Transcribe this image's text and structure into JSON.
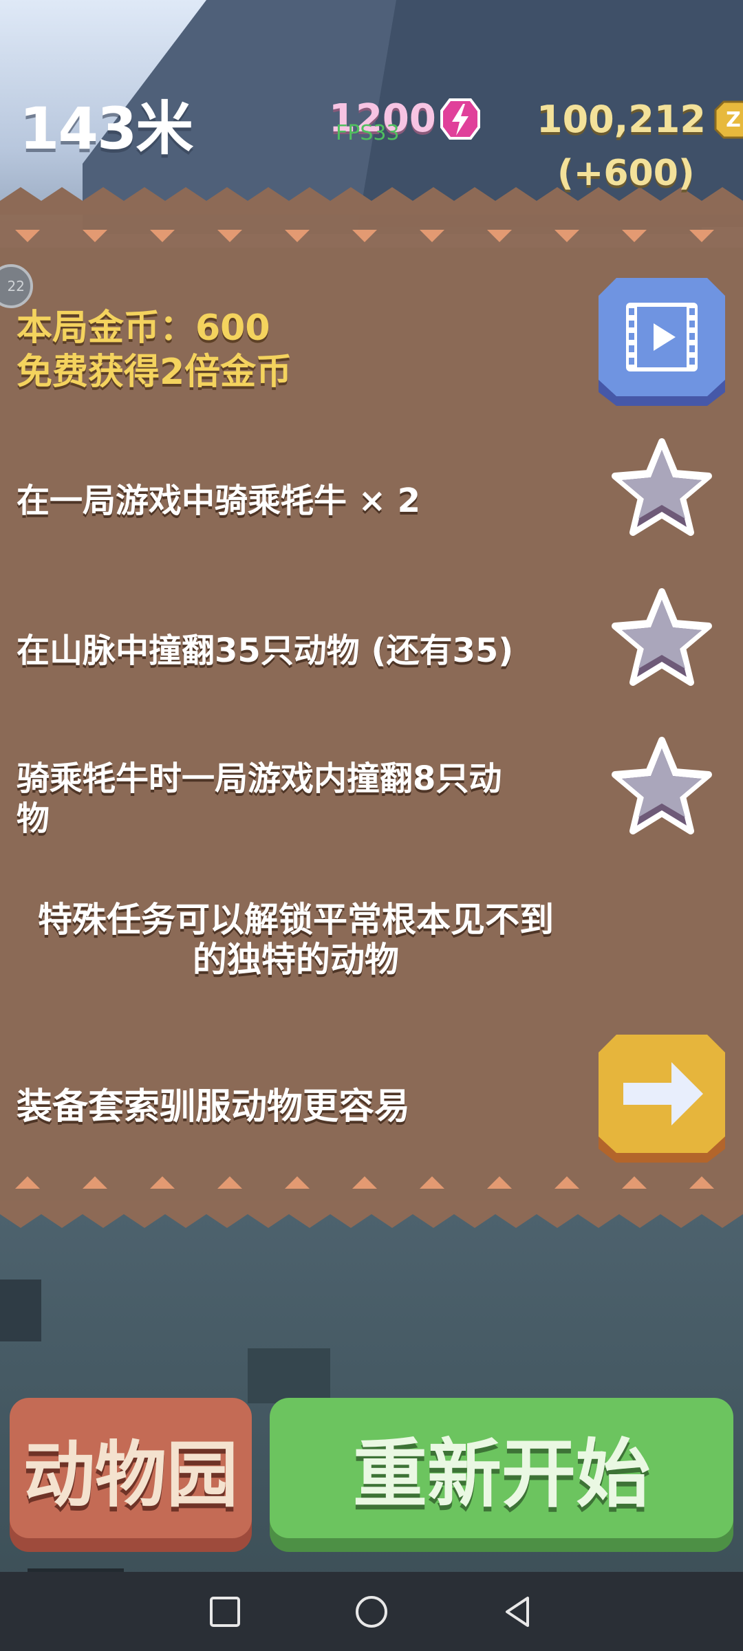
{
  "hud": {
    "distance": "143米",
    "energy": "1200",
    "fps": "FPS33",
    "coins": "100,212",
    "coins_bonus": "(+600)",
    "badge": "22"
  },
  "reward": {
    "line1": "本局金币：600",
    "line2": "免费获得2倍金币"
  },
  "missions": [
    {
      "text": "在一局游戏中骑乘牦牛 × 2"
    },
    {
      "text": "在山脉中撞翻35只动物 (还有35)"
    },
    {
      "text": "骑乘牦牛时一局游戏内撞翻8只动",
      "text2": "物"
    }
  ],
  "tip": {
    "line1": "特殊任务可以解锁平常根本见不到",
    "line2": "的独特的动物"
  },
  "lasso": {
    "text": "装备套索驯服动物更容易"
  },
  "buttons": {
    "zoo": "动物园",
    "restart": "重新开始"
  },
  "colors": {
    "panel": "#8d6a56",
    "gold_text": "#f4d35e",
    "zoo_button": "#c46b55",
    "restart_button": "#6cc45f",
    "video_button": "#6b8fdd",
    "arrow_button": "#e6b53c"
  },
  "icons": {
    "energy": "lightning-icon",
    "coin": "coin-icon",
    "video": "film-play-icon",
    "star": "star-icon",
    "arrow": "arrow-right-icon",
    "nav_recent": "square-icon",
    "nav_home": "circle-icon",
    "nav_back": "triangle-back-icon"
  }
}
